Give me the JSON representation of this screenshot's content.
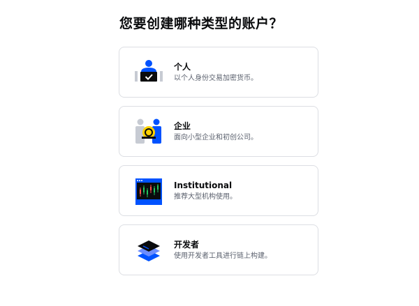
{
  "page": {
    "title": "您要创建哪种类型的账户？"
  },
  "account_types": [
    {
      "label": "个人",
      "description": "以个人身份交易加密货币。",
      "icon": "person-laptop-icon"
    },
    {
      "label": "企业",
      "description": "面向小型企业和初创公司。",
      "icon": "business-people-coin-icon"
    },
    {
      "label": "Institutional",
      "description": "推荐大型机构使用。",
      "icon": "trading-chart-monitor-icon"
    },
    {
      "label": "开发者",
      "description": "使用开发者工具进行链上构建。",
      "icon": "developer-stack-icon"
    }
  ],
  "colors": {
    "brand_blue": "#0052ff",
    "dark": "#0a0b0d",
    "muted_text": "#5b616e",
    "card_border": "#dcdee3",
    "gray_light": "#c7cbd3",
    "coin_yellow": "#ffd200"
  }
}
